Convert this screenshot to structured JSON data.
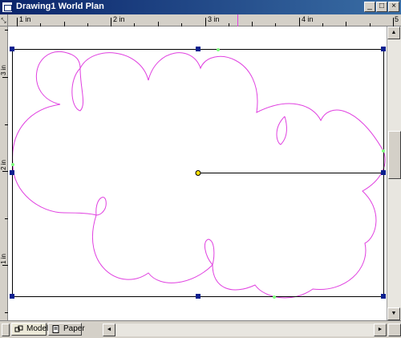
{
  "window": {
    "title": "Drawing1 World Plan"
  },
  "controls": {
    "minimize": "_",
    "restore": "□",
    "close": "×"
  },
  "rulers": {
    "horizontal_labels": [
      "1 in",
      "2 in",
      "3 in",
      "4 in",
      "5"
    ],
    "vertical_labels": [
      "3 in",
      "2 in",
      "1 in"
    ],
    "corner_glyph": "⤡"
  },
  "tabs": [
    {
      "label": "Model",
      "active": true,
      "icon": "model-icon"
    },
    {
      "label": "Paper",
      "active": false,
      "icon": "paper-icon"
    }
  ],
  "scroll": {
    "up": "▲",
    "down": "▼",
    "left": "◄",
    "right": "►"
  },
  "colors": {
    "cloud": "#e040e0",
    "handle": "#0a1f8f",
    "anchor": "#ffe000",
    "titlebar": "#0a246a"
  }
}
